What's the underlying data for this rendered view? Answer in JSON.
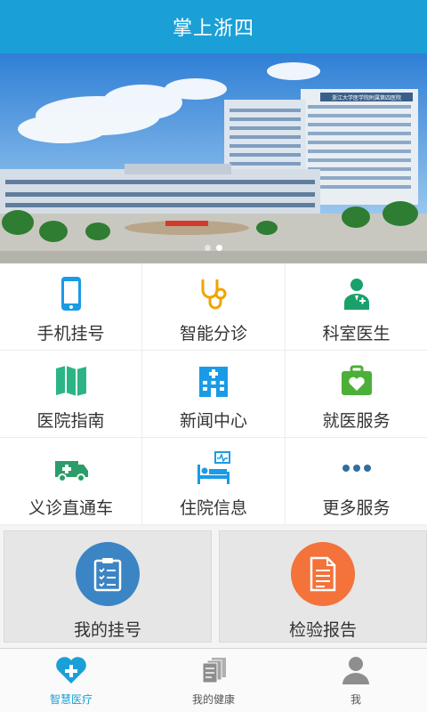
{
  "header": {
    "title": "掌上浙四"
  },
  "banner": {
    "sign_text": "浙江大学医学院附属第四医院",
    "slides": 2,
    "active_slide": 1
  },
  "grid": [
    {
      "label": "手机挂号",
      "icon": "phone-icon",
      "color": "#1a9be6"
    },
    {
      "label": "智能分诊",
      "icon": "stethoscope-icon",
      "color": "#f0a400"
    },
    {
      "label": "科室医生",
      "icon": "doctor-icon",
      "color": "#1aa06b"
    },
    {
      "label": "医院指南",
      "icon": "map-icon",
      "color": "#2bb585"
    },
    {
      "label": "新闻中心",
      "icon": "hospital-building-icon",
      "color": "#1a9be6"
    },
    {
      "label": "就医服务",
      "icon": "medical-kit-icon",
      "color": "#4caf38"
    },
    {
      "label": "义诊直通车",
      "icon": "ambulance-icon",
      "color": "#2a9d6a"
    },
    {
      "label": "住院信息",
      "icon": "hospital-bed-icon",
      "color": "#1a9be6"
    },
    {
      "label": "更多服务",
      "icon": "more-dots-icon",
      "color": "#2f6fa0"
    }
  ],
  "cards": [
    {
      "label": "我的挂号",
      "icon": "clipboard-icon",
      "color": "#3b85c4"
    },
    {
      "label": "检验报告",
      "icon": "document-icon",
      "color": "#f3733a"
    }
  ],
  "tabs": [
    {
      "label": "智慧医疗",
      "icon": "heart-plus-icon",
      "active": true
    },
    {
      "label": "我的健康",
      "icon": "files-icon",
      "active": false
    },
    {
      "label": "我",
      "icon": "user-icon",
      "active": false
    }
  ],
  "colors": {
    "primary": "#1aa0d6",
    "background": "#f4f4f4"
  }
}
